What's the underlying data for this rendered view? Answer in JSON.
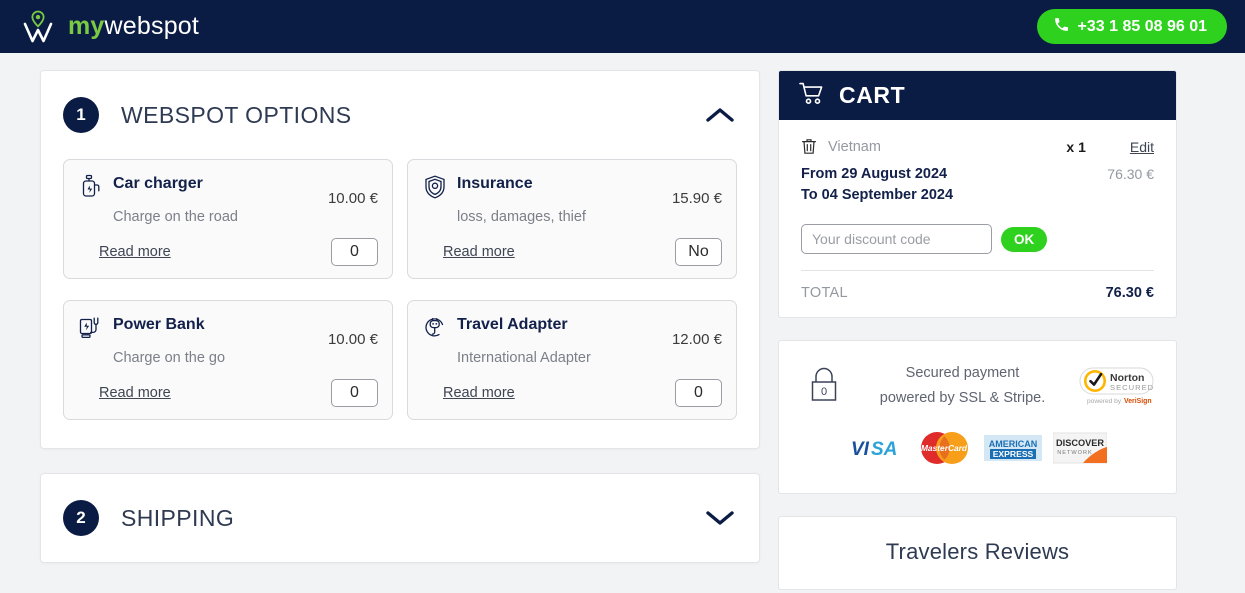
{
  "header": {
    "brand_my": "my",
    "brand_rest": "webspot",
    "logo_icon": "map-pin-w-logo",
    "phone_icon": "phone-icon",
    "phone_label": "+33 1 85 08 96 01",
    "accent_green": "#2fd11f",
    "navy": "#0b1c44"
  },
  "sections": [
    {
      "number": "1",
      "title": "WEBSPOT OPTIONS",
      "expanded": true,
      "chevron_icon": "chevron-up-icon"
    },
    {
      "number": "2",
      "title": "SHIPPING",
      "expanded": false,
      "chevron_icon": "chevron-down-icon"
    }
  ],
  "options": [
    {
      "icon": "car-charger-icon",
      "name": "Car charger",
      "desc": "Charge on the road",
      "price": "10.00 €",
      "read_more": "Read more",
      "value": "0"
    },
    {
      "icon": "shield-insurance-icon",
      "name": "Insurance",
      "desc": "loss, damages, thief",
      "price": "15.90 €",
      "read_more": "Read more",
      "value": "No"
    },
    {
      "icon": "power-bank-icon",
      "name": "Power Bank",
      "desc": "Charge on the go",
      "price": "10.00 €",
      "read_more": "Read more",
      "value": "0"
    },
    {
      "icon": "travel-adapter-icon",
      "name": "Travel Adapter",
      "desc": "International Adapter",
      "price": "12.00 €",
      "read_more": "Read more",
      "value": "0"
    }
  ],
  "cart": {
    "icon": "shopping-cart-icon",
    "title": "CART",
    "item": {
      "remove_icon": "trash-icon",
      "destination": "Vietnam",
      "quantity": "x 1",
      "edit_label": "Edit",
      "date_from": "From 29 August 2024",
      "date_to": "To 04 September 2024",
      "subtotal": "76.30 €"
    },
    "discount_placeholder": "Your discount code",
    "discount_value": "",
    "ok_label": "OK",
    "total_label": "TOTAL",
    "total_value": "76.30 €"
  },
  "secure": {
    "lock_icon": "padlock-icon",
    "lock_text": "0",
    "line1": "Secured payment",
    "line2": "powered by SSL & Stripe.",
    "badge_icon": "norton-secured-badge",
    "badge_title": "Norton",
    "badge_sub": "SECURED",
    "badge_footer_prefix": "powered by",
    "badge_footer_brand": "VeriSign",
    "cards": [
      {
        "icon": "visa-logo",
        "label": "VISA"
      },
      {
        "icon": "mastercard-logo",
        "label": "MasterCard"
      },
      {
        "icon": "amex-logo",
        "label_line1": "AMERICAN",
        "label_line2": "EXPRESS"
      },
      {
        "icon": "discover-logo",
        "label_line1": "DISCOVER",
        "label_line2": "NETWORK"
      }
    ]
  },
  "reviews": {
    "title": "Travelers Reviews"
  }
}
